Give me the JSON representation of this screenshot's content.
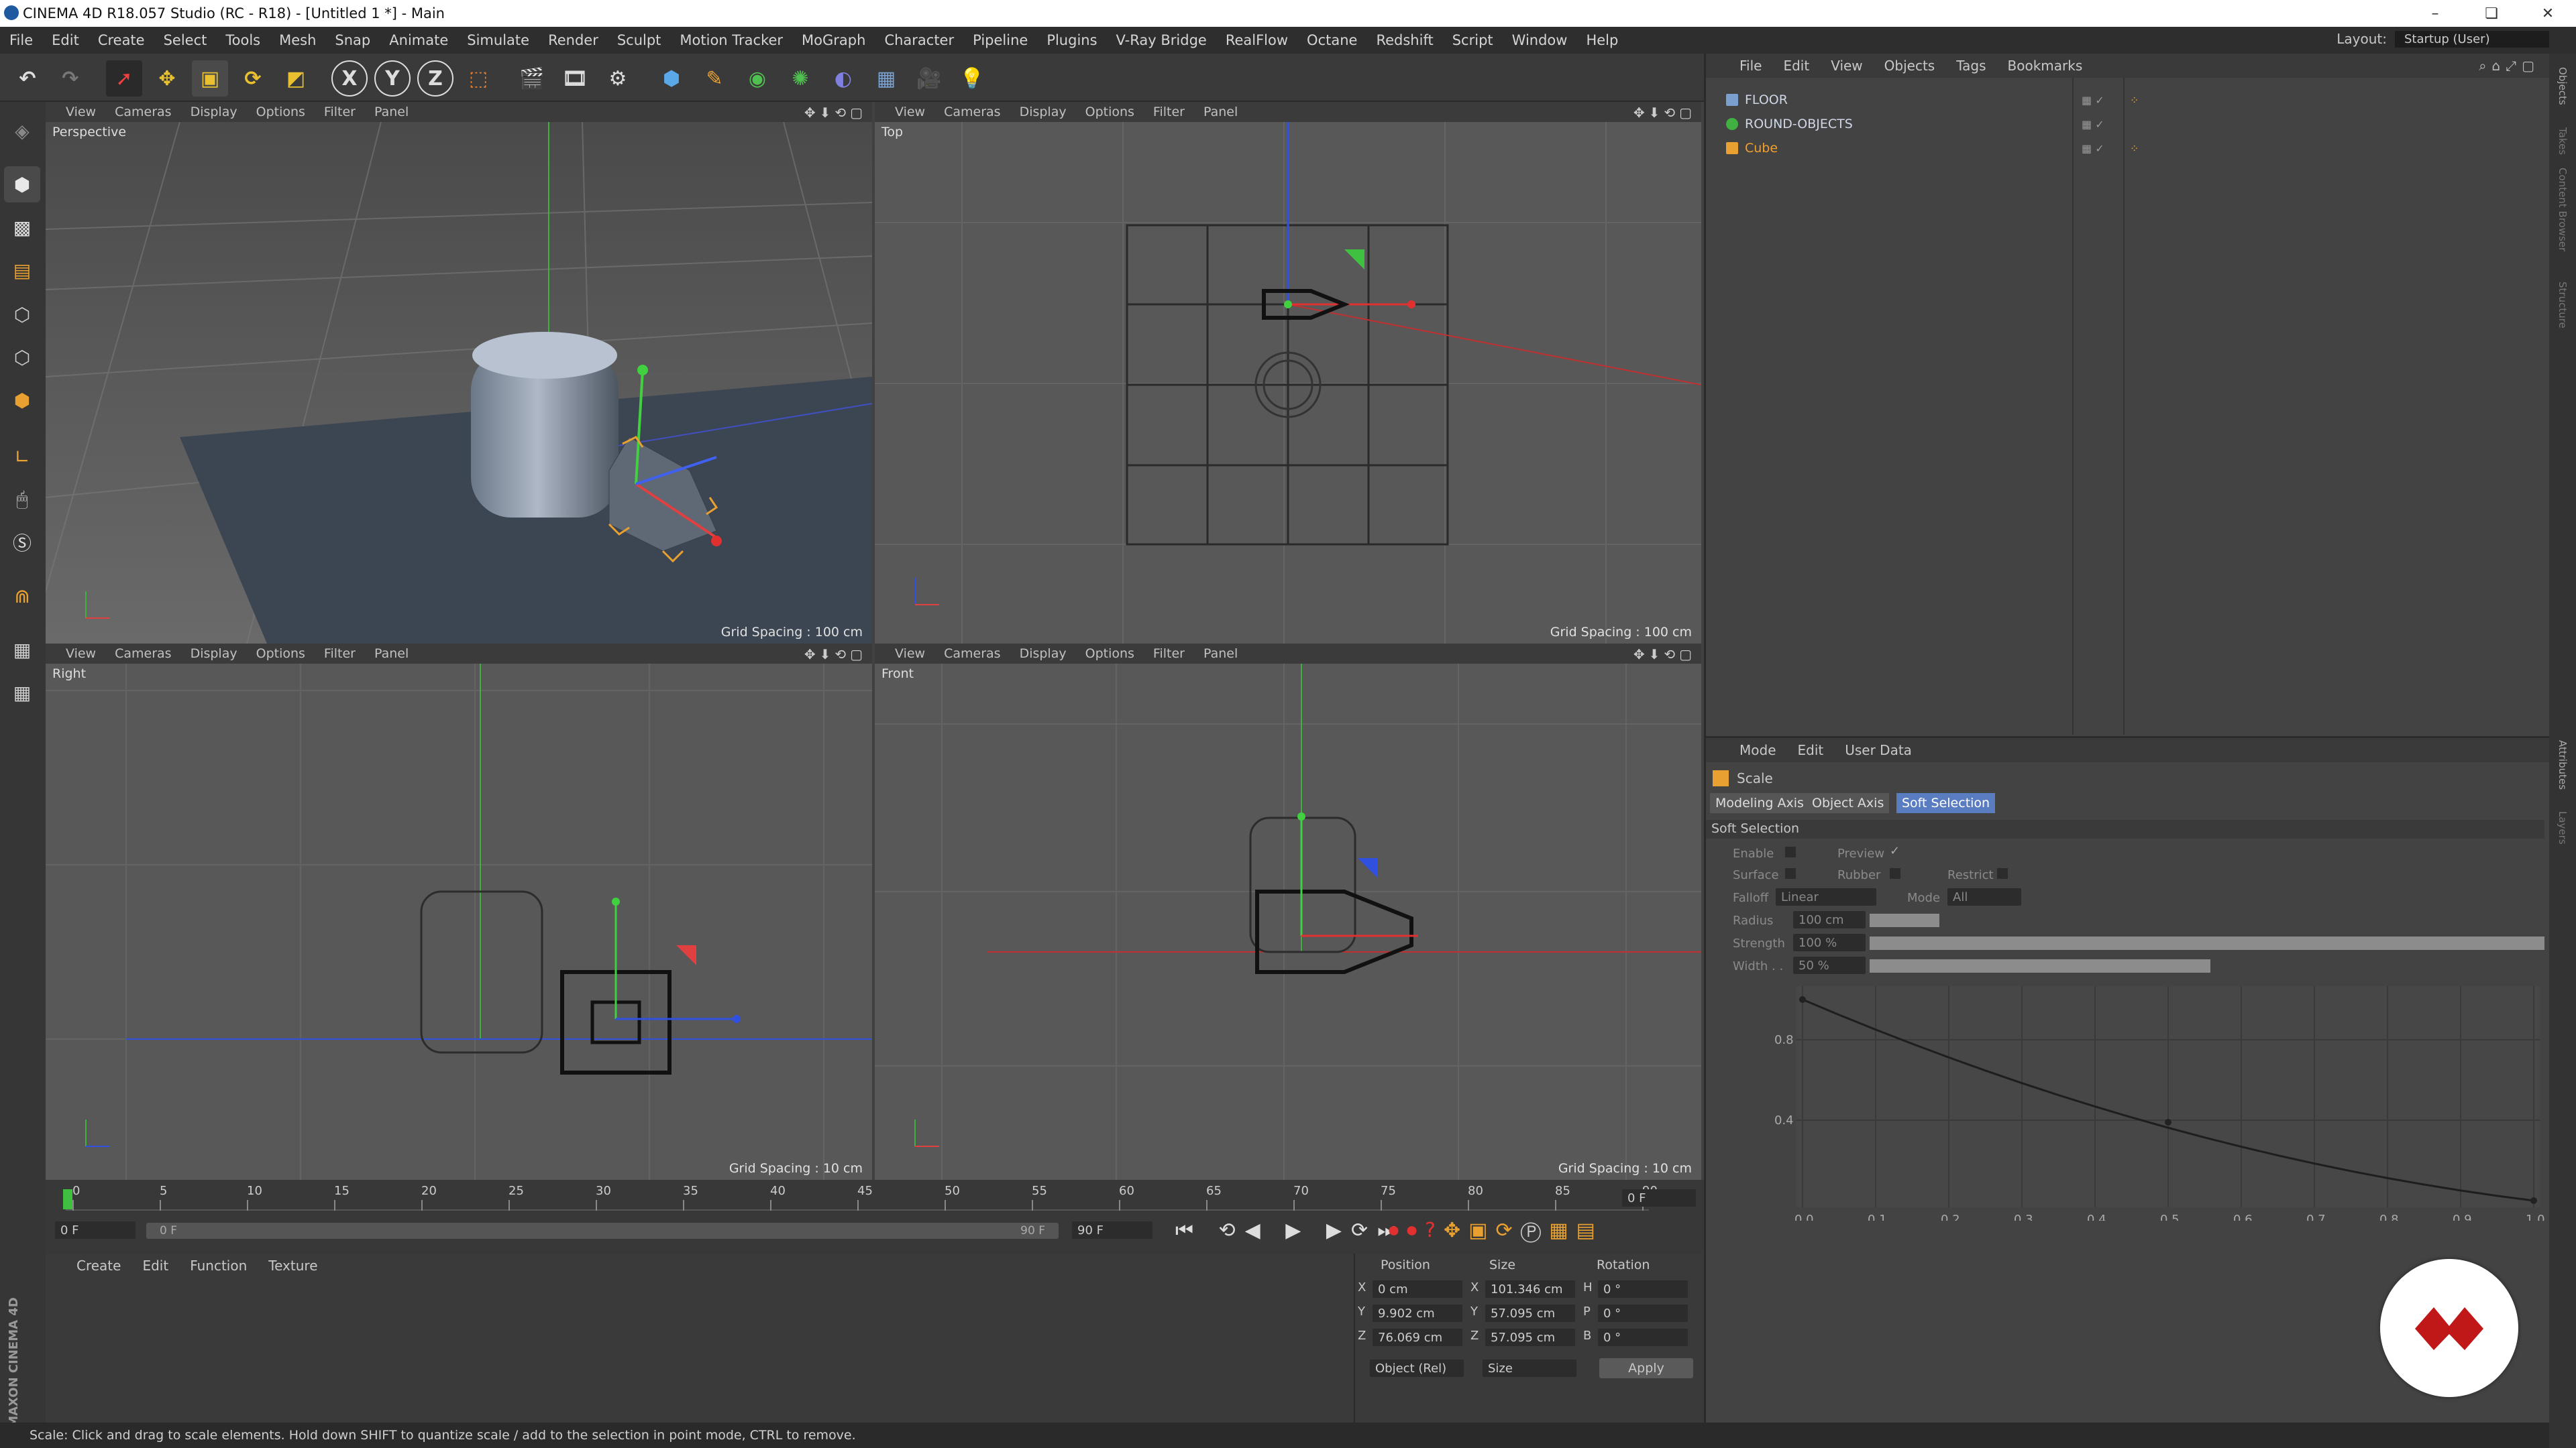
{
  "window": {
    "title": "CINEMA 4D R18.057 Studio (RC - R18) - [Untitled 1 *] - Main",
    "controls": [
      "–",
      "❏",
      "✕"
    ]
  },
  "menu": [
    "File",
    "Edit",
    "Create",
    "Select",
    "Tools",
    "Mesh",
    "Snap",
    "Animate",
    "Simulate",
    "Render",
    "Sculpt",
    "Motion Tracker",
    "MoGraph",
    "Character",
    "Pipeline",
    "Plugins",
    "V-Ray Bridge",
    "RealFlow",
    "Octane",
    "Redshift",
    "Script",
    "Window",
    "Help"
  ],
  "layout": {
    "label": "Layout:",
    "value": "Startup (User)"
  },
  "toolbar": {
    "axis_x": "X",
    "axis_y": "Y",
    "axis_z": "Z"
  },
  "viewport_menu": [
    "View",
    "Cameras",
    "Display",
    "Options",
    "Filter",
    "Panel"
  ],
  "viewports": {
    "perspective": {
      "label": "Perspective",
      "grid": "Grid Spacing : 100 cm"
    },
    "top": {
      "label": "Top",
      "grid": "Grid Spacing : 100 cm"
    },
    "right": {
      "label": "Right",
      "grid": "Grid Spacing : 10 cm"
    },
    "front": {
      "label": "Front",
      "grid": "Grid Spacing : 10 cm"
    }
  },
  "timeline": {
    "ticks": [
      "0",
      "5",
      "10",
      "15",
      "20",
      "25",
      "30",
      "35",
      "40",
      "45",
      "50",
      "55",
      "60",
      "65",
      "70",
      "75",
      "80",
      "85",
      "90"
    ],
    "current_frame": "0 F",
    "start": "0 F",
    "range_start": "0 F",
    "range_end": "90 F",
    "end": "90 F"
  },
  "materials": {
    "menu": [
      "Create",
      "Edit",
      "Function",
      "Texture"
    ]
  },
  "coords": {
    "headers": [
      "Position",
      "Size",
      "Rotation"
    ],
    "rows": [
      {
        "axis": "X",
        "pos": "0 cm",
        "saxis": "X",
        "size": "101.346 cm",
        "raxis": "H",
        "rot": "0 °"
      },
      {
        "axis": "Y",
        "pos": "9.902 cm",
        "saxis": "Y",
        "size": "57.095 cm",
        "raxis": "P",
        "rot": "0 °"
      },
      {
        "axis": "Z",
        "pos": "76.069 cm",
        "saxis": "Z",
        "size": "57.095 cm",
        "raxis": "B",
        "rot": "0 °"
      }
    ],
    "mode": "Object (Rel)",
    "size_mode": "Size",
    "apply": "Apply"
  },
  "objects": {
    "menu": [
      "File",
      "Edit",
      "View",
      "Objects",
      "Tags",
      "Bookmarks"
    ],
    "items": [
      {
        "name": "FLOOR",
        "color": "#cfd6e6"
      },
      {
        "name": "ROUND-OBJECTS",
        "color": "#cfd6e6"
      },
      {
        "name": "Cube",
        "color": "#f0a030"
      }
    ]
  },
  "attributes": {
    "menu": [
      "Mode",
      "Edit",
      "User Data"
    ],
    "tool": "Scale",
    "tabs": [
      "Modeling Axis",
      "Object Axis",
      "Soft Selection"
    ],
    "section": "Soft Selection",
    "enable": "Enable",
    "preview": "Preview",
    "surface": "Surface",
    "rubber": "Rubber",
    "restrict": "Restrict",
    "falloff_label": "Falloff",
    "falloff": "Linear",
    "mode_label": "Mode",
    "mode": "All",
    "radius_label": "Radius",
    "radius": "100 cm",
    "strength_label": "Strength",
    "strength": "100 %",
    "width_label": "Width . .",
    "width": "50 %",
    "graph_y": [
      "0.8",
      "0.4"
    ],
    "graph_x": [
      "0.0",
      "0.1",
      "0.2",
      "0.3",
      "0.4",
      "0.5",
      "0.6",
      "0.7",
      "0.8",
      "0.9",
      "1.0"
    ]
  },
  "status": "Scale: Click and drag to scale elements. Hold down SHIFT to quantize scale / add to the selection in point mode, CTRL to remove.",
  "brand": "MAXON CINEMA 4D",
  "right_tabs": [
    "Objects",
    "Takes",
    "Content Browser",
    "Structure"
  ],
  "right_tabs2": [
    "Attributes",
    "Layers"
  ]
}
